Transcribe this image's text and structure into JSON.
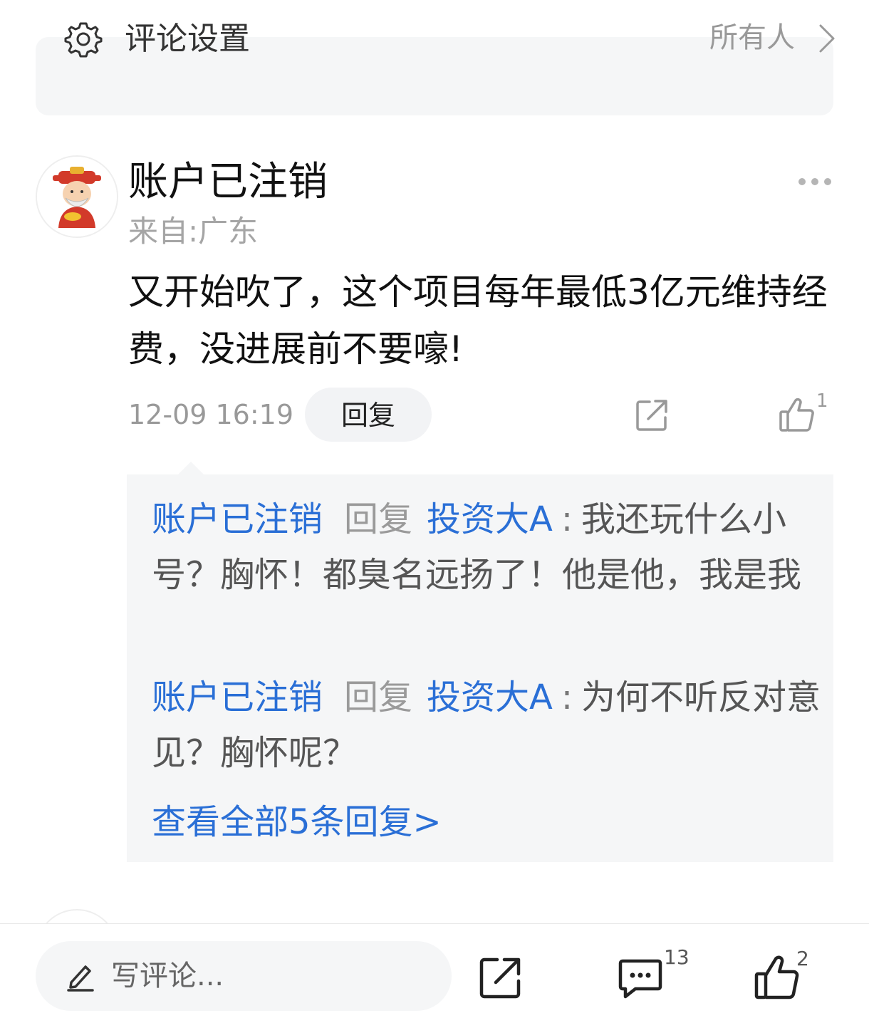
{
  "settings": {
    "label": "评论设置",
    "value": "所有人"
  },
  "comment": {
    "username": "账户已注销",
    "location": "来自:广东",
    "text": "又开始吹了，这个项目每年最低3亿元维持经费，没进展前不要嚎!",
    "timestamp": "12-09 16:19",
    "reply_label": "回复",
    "like_count": "1"
  },
  "replies": [
    {
      "author": "账户已注销",
      "verb": "回复",
      "target": "投资大A",
      "colon": ":",
      "text": "我还玩什么小号？胸怀！都臭名远扬了！他是他，我是我"
    },
    {
      "author": "账户已注销",
      "verb": "回复",
      "target": "投资大A",
      "colon": ":",
      "text": "为何不听反对意见？胸怀呢？"
    }
  ],
  "view_all": "查看全部5条回复>",
  "bottom_bar": {
    "placeholder": "写评论...",
    "comments_count": "13",
    "likes_count": "2"
  },
  "colors": {
    "link": "#2a6fd6",
    "muted": "#999999",
    "panel": "#f5f6f7"
  }
}
